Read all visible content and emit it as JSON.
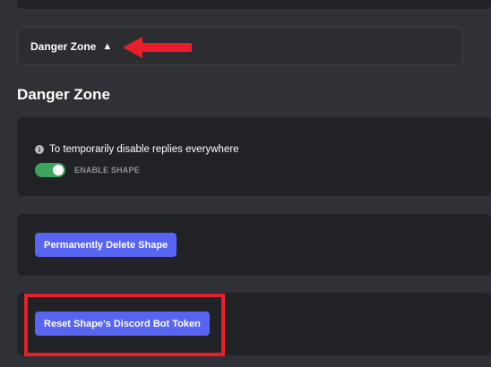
{
  "danger_zone_toggle": {
    "label": "Danger Zone",
    "caret": "▲"
  },
  "section": {
    "title": "Danger Zone"
  },
  "disable_card": {
    "info_text": "To temporarily disable replies everywhere",
    "info_icon": "info-icon",
    "toggle_label": "ENABLE SHAPE",
    "toggle_on": true
  },
  "delete_card": {
    "button_label": "Permanently Delete Shape"
  },
  "reset_card": {
    "button_label": "Reset Shape's Discord Bot Token"
  },
  "colors": {
    "background": "#2f3136",
    "card": "#202225",
    "accent_button": "#5865f2",
    "toggle_on": "#3ba55c",
    "annotation_red": "#e81f28"
  }
}
